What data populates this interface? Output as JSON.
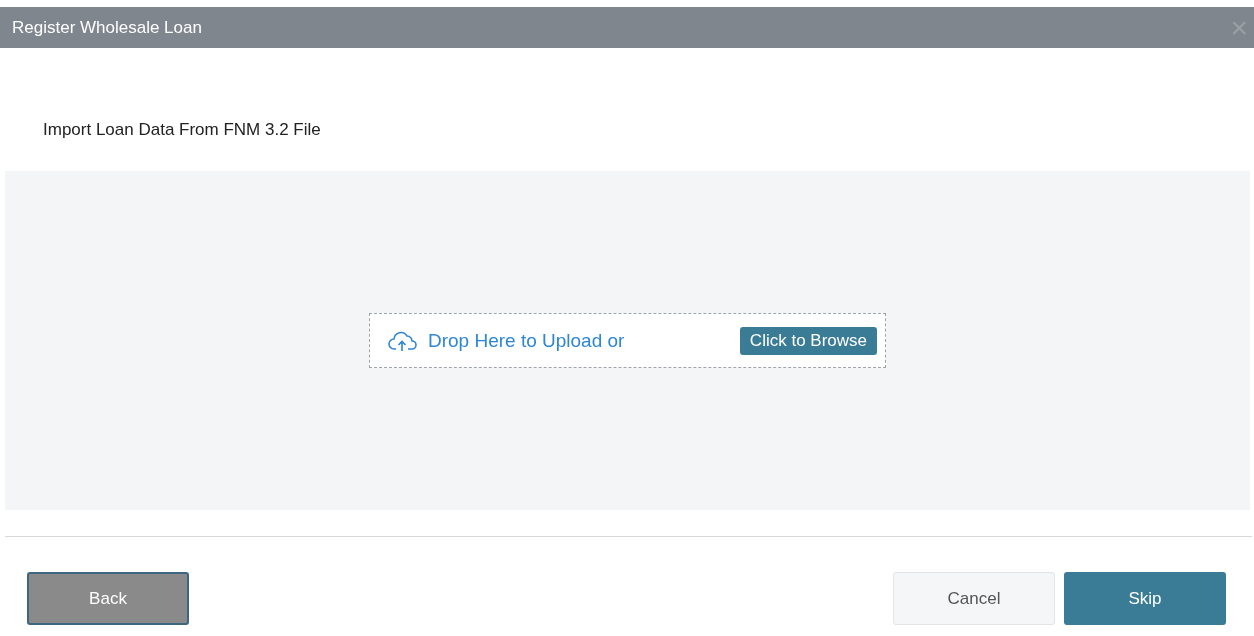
{
  "window": {
    "title": "Register Wholesale Loan",
    "close": "×"
  },
  "heading": "Import Loan Data From FNM 3.2 File",
  "dropzone": {
    "text": "Drop Here to Upload or",
    "browse": "Click to Browse"
  },
  "buttons": [
    {
      "label": "Back",
      "kind": "back"
    },
    {
      "label": "Cancel",
      "kind": "cancel"
    },
    {
      "label": "Skip",
      "kind": "primary"
    }
  ]
}
